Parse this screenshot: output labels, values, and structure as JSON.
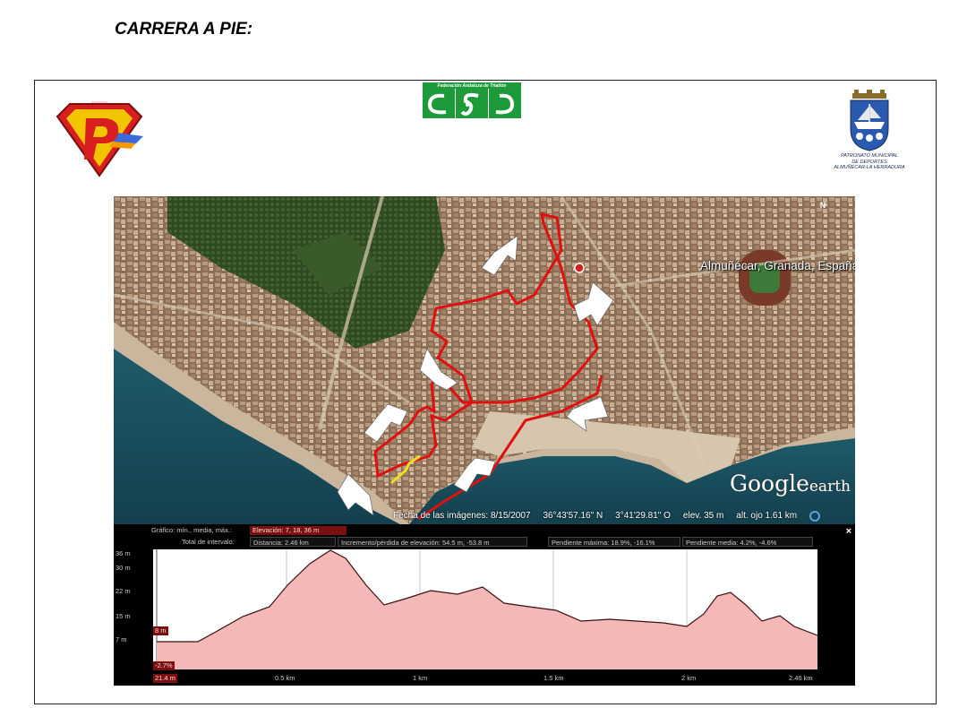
{
  "heading": "CARRERA A PIE:",
  "logos": {
    "federation_text": "Federación Andaluza de Triatlón",
    "patronato_lines": [
      "PATRONATO MUNICIPAL",
      "DE DEPORTES",
      "ALMUÑÉCAR-LA HERRADURA"
    ]
  },
  "map": {
    "place_label": "Almuñécar, Granada, España",
    "google": "Google",
    "earth": "earth",
    "north": "N",
    "status": {
      "image_date": "Fecha de las imágenes: 8/15/2007",
      "lat": "36°43'57.16\" N",
      "lon": "3°41'29.81\" O",
      "elev": "elev.    35 m",
      "eye_alt": "alt. ojo    1.61 km"
    },
    "colors": {
      "route": "#e01010",
      "highlight": "#f0e020",
      "arrow": "#ffffff"
    }
  },
  "profile": {
    "graph_label": "Gráfico: mín., media, máx.:",
    "elevation_label": "Elevación: 7, 18, 36 m",
    "total_label": "Total de intervalo:",
    "distance": "Distancia: 2.46 km",
    "gain_loss": "Incremento/pérdida de elevación: 54.5 m, -53.8 m",
    "max_slope": "Pendiente máxima: 18.9%, -16.1%",
    "avg_slope": "Pendiente media: 4.2%, -4.6%",
    "close": "×",
    "y_ticks": [
      "36 m",
      "30 m",
      "22 m",
      "15 m",
      "7 m"
    ],
    "x_ticks": [
      "0.5 km",
      "1 km",
      "1.5 km",
      "2 km",
      "2.46 km"
    ],
    "cursor_elev": "8 m",
    "cursor_slope": "-2.7%",
    "cursor_dist": "21.4 m",
    "fill_color": "#f4b8b8",
    "line_color": "#3a1010"
  }
}
